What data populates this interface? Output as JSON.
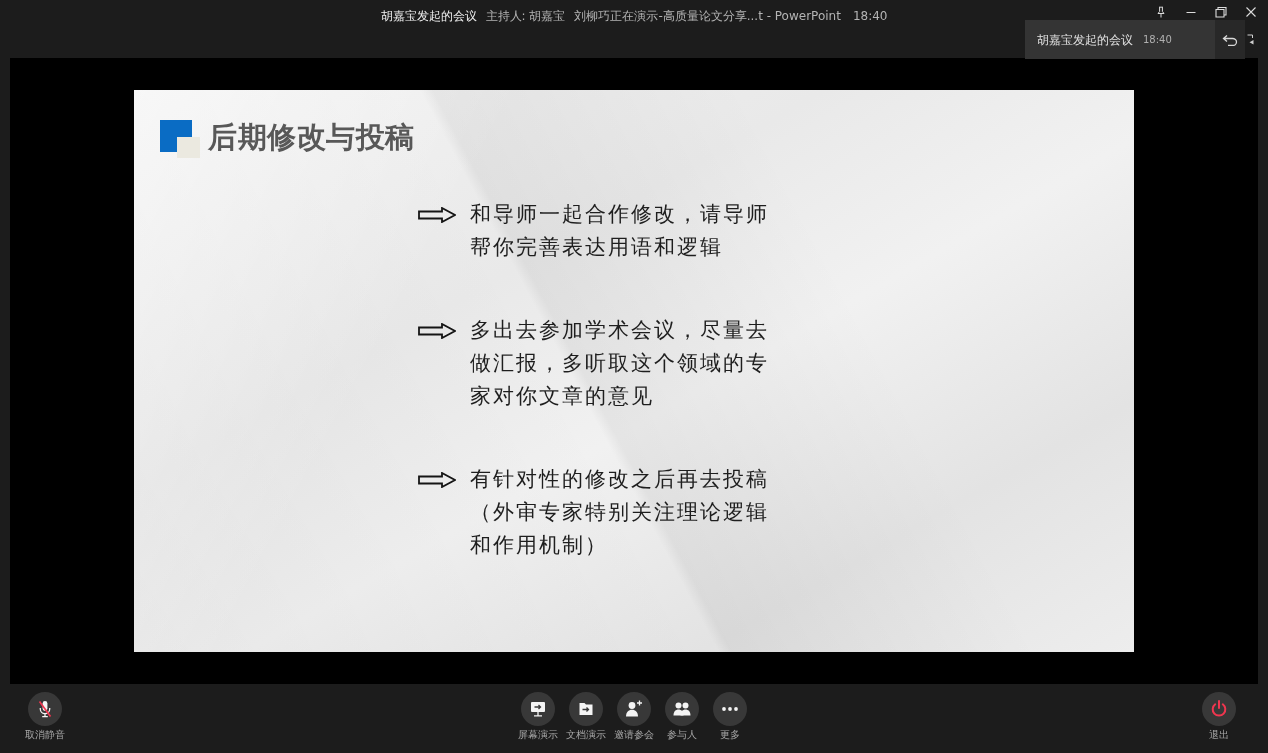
{
  "title_bar": {
    "meeting_title": "胡嘉宝发起的会议",
    "host": "主持人: 胡嘉宝",
    "presentation": "刘柳巧正在演示-高质量论文分享...t - PowerPoint",
    "time": "18:40"
  },
  "notification": {
    "title": "胡嘉宝发起的会议",
    "time": "18:40"
  },
  "slide": {
    "title": "后期修改与投稿",
    "bullets": [
      "和导师一起合作修改，请导师帮你完善表达用语和逻辑",
      "多出去参加学术会议，尽量去做汇报，多听取这个领域的专家对你文章的意见",
      "有针对性的修改之后再去投稿（外审专家特别关注理论逻辑和作用机制）"
    ]
  },
  "toolbar": {
    "left": [
      {
        "kind": "mic",
        "label": "取消静音",
        "muted": true
      }
    ],
    "center": [
      {
        "kind": "screen",
        "label": "屏幕演示"
      },
      {
        "kind": "document",
        "label": "文档演示"
      },
      {
        "kind": "invite",
        "label": "邀请参会"
      },
      {
        "kind": "participants",
        "label": "参与人"
      },
      {
        "kind": "more",
        "label": "更多"
      }
    ],
    "right": [
      {
        "kind": "exit",
        "label": "退出"
      }
    ]
  }
}
